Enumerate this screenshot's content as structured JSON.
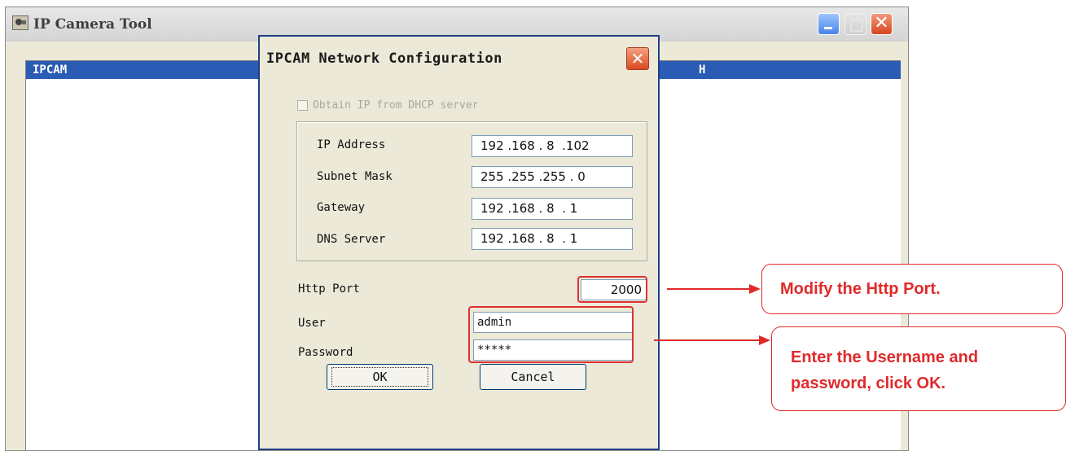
{
  "main_window": {
    "title": "IP Camera Tool",
    "list_header_left": "IPCAM",
    "list_header_right": "H",
    "close_glyph": "✕"
  },
  "dialog": {
    "title": "IPCAM Network Configuration",
    "close_glyph": "✕",
    "dhcp_label": "Obtain IP from DHCP server",
    "dhcp_checked": false,
    "ip_address_label": "IP Address",
    "ip_address_value": "192 .168 . 8  .102",
    "subnet_mask_label": "Subnet Mask",
    "subnet_mask_value": "255 .255 .255 . 0",
    "gateway_label": "Gateway",
    "gateway_value": "192 .168 . 8  . 1",
    "dns_server_label": "DNS Server",
    "dns_server_value": "192 .168 . 8  . 1",
    "http_port_label": "Http Port",
    "http_port_value": "2000",
    "user_label": "User",
    "user_value": "admin",
    "password_label": "Password",
    "password_value": "*****",
    "ok_label": "OK",
    "cancel_label": "Cancel"
  },
  "annotations": {
    "callout_port": "Modify the Http Port.",
    "callout_login_line1": "Enter the Username and",
    "callout_login_line2": "password, click OK.",
    "color": "#e02a2a"
  }
}
